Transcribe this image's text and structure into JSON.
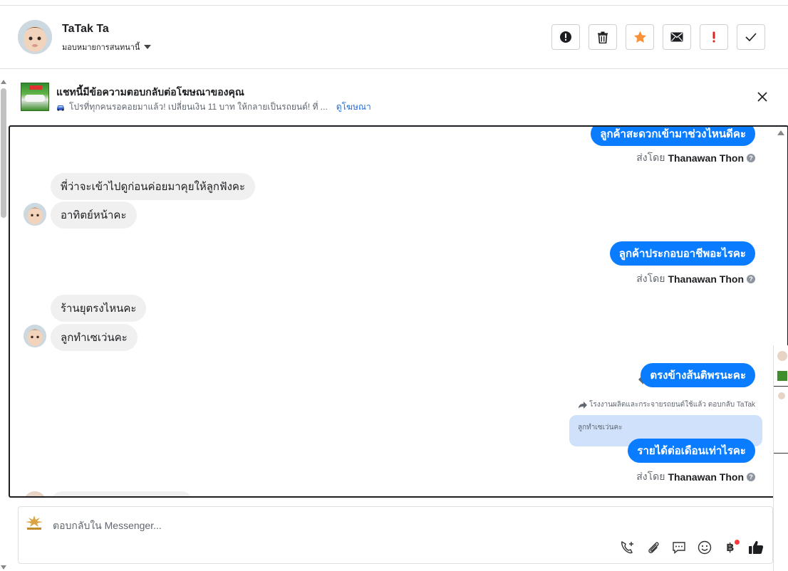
{
  "header": {
    "contact_name": "TaTak Ta",
    "assign_label": "มอบหมายการสนทนานี้",
    "actions": [
      {
        "name": "spam-button",
        "icon": "alert-circle-icon"
      },
      {
        "name": "delete-button",
        "icon": "trash-icon"
      },
      {
        "name": "star-button",
        "icon": "star-icon"
      },
      {
        "name": "mark-unread-button",
        "icon": "envelope-icon"
      },
      {
        "name": "follow-up-button",
        "icon": "exclamation-icon"
      },
      {
        "name": "done-button",
        "icon": "checkmark-icon"
      }
    ]
  },
  "ad_banner": {
    "title": "แชทนี้มีข้อความตอบกลับต่อโฆษณาของคุณ",
    "subtitle": "โปรที่ทุกคนรอคอยมาแล้ว! เปลี่ยนเงิน 11 บาท ให้กลายเป็นรถยนต์! ที่ ...",
    "link": "ดูโฆษณา"
  },
  "messages": {
    "out_1": "ลูกค้าสะดวกเข้ามาช่วงไหนดีคะ",
    "in_1": "พี่ว่าจะเข้าไปดูก่อนค่อยมาคุยให้ลูกฟังคะ",
    "in_2": "อาทิตย์หน้าคะ",
    "out_2": "ลูกค้าประกอบอาชีพอะไรคะ",
    "in_3": "ร้านยุตรงไหนคะ",
    "in_4": "ลูกทำเซเว่นคะ",
    "out_3": "ตรงข้างส้นติพรนะคะ",
    "out_4": "รายได้ต่อเดือนเท่าไรคะ",
    "sent_by_prefix": "ส่งโดย",
    "sender_name": "Thanawan Thon",
    "reply_note": "โรงงานผลิตและกระจายรถยนต์ใช้แล้ว ตอบกลับ TaTak",
    "quoted_text": "ลูกทำเซเว่นคะ"
  },
  "composer": {
    "placeholder": "ตอบกลับใน Messenger...",
    "tools": [
      "call-add-icon",
      "attachment-icon",
      "saved-reply-icon",
      "emoji-icon",
      "baht-payment-icon",
      "like-icon"
    ],
    "baht_symbol": "฿"
  },
  "colors": {
    "accent_blue": "#0a7cff",
    "incoming_bubble": "#f0f0f0",
    "quoted_bubble": "#cfe1fb",
    "link": "#216fdb",
    "star": "#f7923a",
    "follow_up": "#e0211d"
  }
}
